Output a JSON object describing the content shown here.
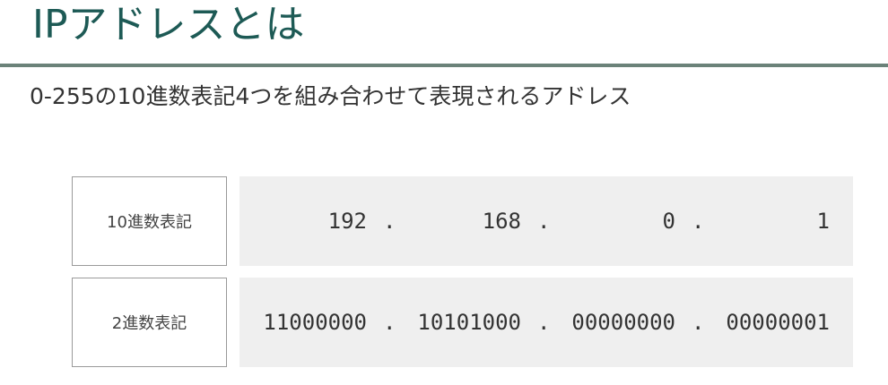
{
  "title": "IPアドレスとは",
  "subtitle": "0-255の10進数表記4つを組み合わせて表現されるアドレス",
  "rows": [
    {
      "label": "10進数表記",
      "octets": [
        "192",
        "168",
        "0",
        "1"
      ]
    },
    {
      "label": "2進数表記",
      "octets": [
        "11000000",
        "10101000",
        "00000000",
        "00000001"
      ]
    }
  ],
  "separator": ".",
  "colors": {
    "title": "#1d5a55",
    "rule": "#6b8279",
    "value_background": "#efefef",
    "label_border": "#9a9a9a"
  }
}
